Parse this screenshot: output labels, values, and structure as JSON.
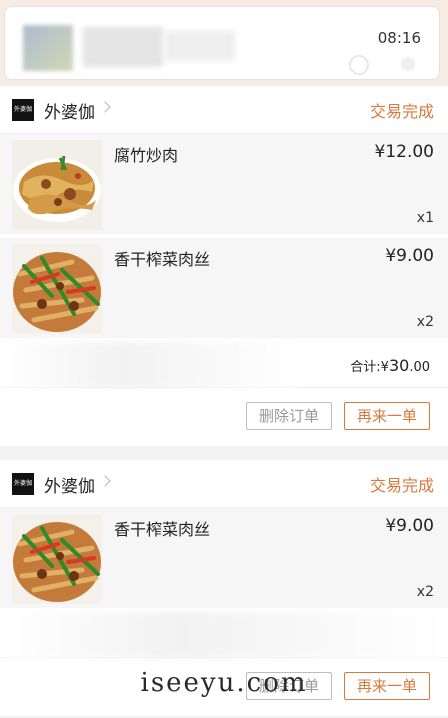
{
  "top": {
    "time": "08:16"
  },
  "orders": [
    {
      "shop": "外婆伽",
      "status": "交易完成",
      "items": [
        {
          "name": "腐竹炒肉",
          "price": "¥12.00",
          "qty": "x1"
        },
        {
          "name": "香干榨菜肉丝",
          "price": "¥9.00",
          "qty": "x2"
        }
      ],
      "total_label": "合计:",
      "total_currency": "¥",
      "total_int": "30",
      "total_dec": ".00",
      "delete_label": "删除订单",
      "reorder_label": "再来一单"
    },
    {
      "shop": "外婆伽",
      "status": "交易完成",
      "items": [
        {
          "name": "香干榨菜肉丝",
          "price": "¥9.00",
          "qty": "x2"
        }
      ],
      "delete_label": "删除订单",
      "reorder_label": "再来一单"
    }
  ],
  "watermark": "iseeyu.com",
  "colors": {
    "accent": "#d9793d",
    "muted_border": "#bdbdbd"
  },
  "icons": {
    "chevron": "chevron-right-icon",
    "logo": "shop-logo-icon"
  }
}
